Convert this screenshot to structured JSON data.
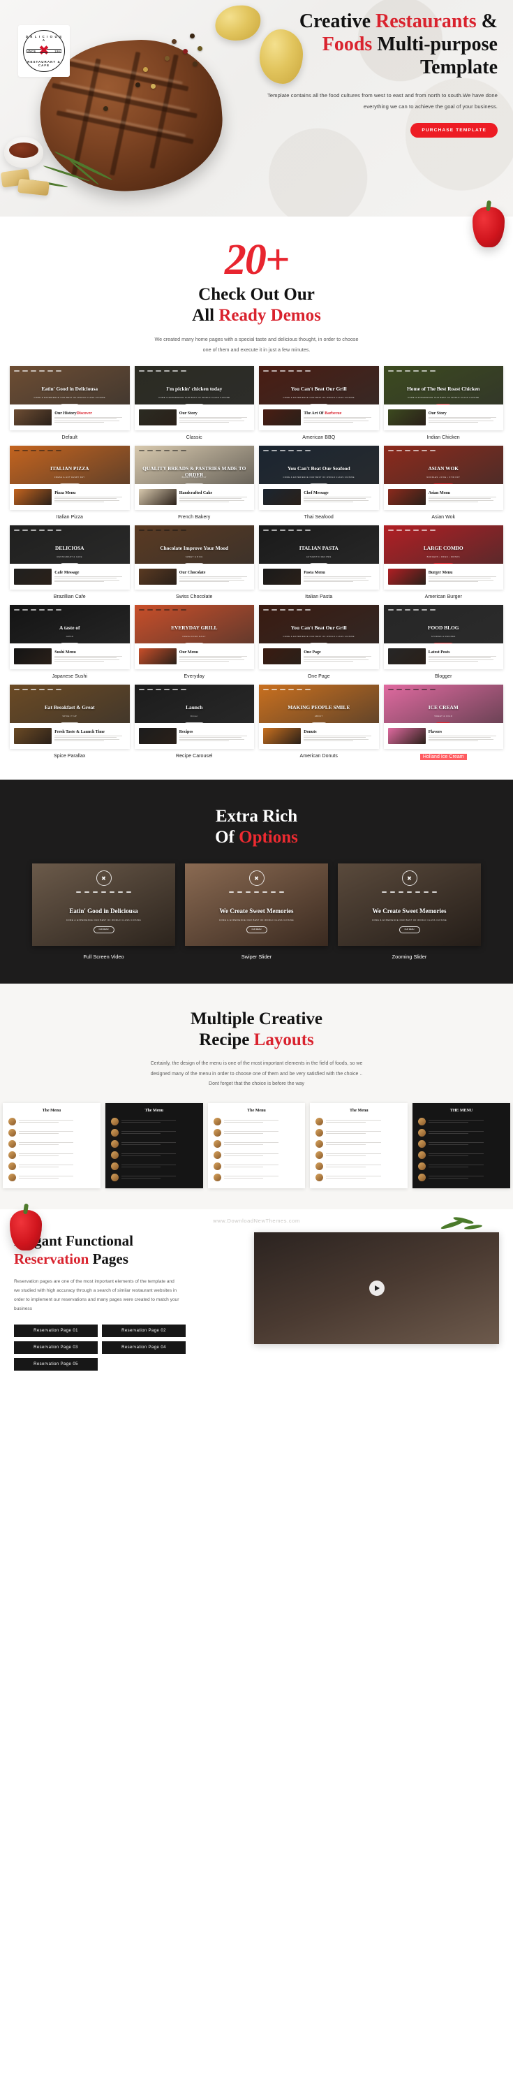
{
  "hero": {
    "logo": {
      "brand": "DELICIOUSA",
      "top_arc": "D E L I C I O U S A",
      "bottom_arc": "RESTAURANT & CAFE",
      "since_left": "SINCE",
      "since_right": "1962",
      "icon": "crossed-fork-spoon-icon"
    },
    "title_line1_a": "Creative ",
    "title_line1_b": "Restaurants ",
    "title_line1_c": "&",
    "title_line2_a": "Foods",
    "title_line2_b": " Multi-purpose",
    "title_line3": "Template",
    "subtitle": "Template contains all the food cultures from west to east and from north to south.We have done everything we can to achieve the goal of your business.",
    "cta_label": "PURCHASE TEMPLATE",
    "cta_color": "#ed1c24"
  },
  "demos": {
    "count_badge": "20+",
    "title_line1": "Check Out Our",
    "title_line2_a": "All ",
    "title_line2_b": "Ready Demos",
    "description": "We created many home pages with a special taste and delicious thought, in order to choose one of them and execute it in just a few minutes.",
    "items": [
      {
        "label": "Default",
        "headline": "Eatin' Good in Deliciousa",
        "sub": "COME & EXPERIENCE OUR BEST OF WORLD CLASS CUISINE",
        "btn": "OUR MENU",
        "lower_title": "Our History",
        "lower_script": "Discover",
        "theme": "dark",
        "accent": "#6d4d33"
      },
      {
        "label": "Classic",
        "headline": "I'm pickin' chicken today",
        "sub": "COME & EXPERIENCE OUR BEST OF WORLD CLASS CUISINE",
        "btn": "OUR MENU",
        "lower_title": "Our Story",
        "lower_script": "",
        "theme": "dark",
        "accent": "#2b2b22"
      },
      {
        "label": "American BBQ",
        "headline": "You Can't Beat Our Grill",
        "sub": "COME & EXPERIENCE OUR BEST OF WORLD CLASS CUISINE",
        "btn": "OUR MENU",
        "lower_title": "The Art Of ",
        "lower_script": "Barbecue",
        "theme": "dark",
        "accent": "#4a1d13"
      },
      {
        "label": "Indian Chicken",
        "headline": "Home of The Best Roast Chicken",
        "sub": "COME & EXPERIENCE OUR BEST OF WORLD CLASS CUISINE",
        "btn": "ORDER",
        "lower_title": "Our Story",
        "lower_script": "",
        "theme": "dark",
        "accent": "#3c4a1f"
      },
      {
        "label": "Italian Pizza",
        "headline": "ITALIAN PIZZA",
        "sub": "FRESH & HOT EVERY DAY",
        "btn": "ORDER NOW",
        "lower_title": "Pizza Menu",
        "lower_script": "",
        "theme": "light",
        "accent": "#c4641f"
      },
      {
        "label": "French Bakery",
        "headline": "QUALITY BREADS & PASTRIES MADE TO ORDER",
        "sub": "BAKED FRESH DAILY",
        "btn": "OUR MENU",
        "lower_title": "Handcrafted Cake",
        "lower_script": "",
        "theme": "light",
        "accent": "#d8c9ae"
      },
      {
        "label": "Thai Seafood",
        "headline": "You Can't Beat Our Seafood",
        "sub": "COME & EXPERIENCE OUR BEST OF WORLD CLASS CUISINE",
        "btn": "OUR MENU",
        "lower_title": "Chef Message",
        "lower_script": "",
        "theme": "dark",
        "accent": "#1b2530"
      },
      {
        "label": "Asian Wok",
        "headline": "ASIAN WOK",
        "sub": "NOODLES • RICE • STIR FRY",
        "btn": "ORDER NOW",
        "lower_title": "Asian Menu",
        "lower_script": "",
        "theme": "dark",
        "accent": "#8c2a1c"
      },
      {
        "label": "Brazillian Cafe",
        "headline": "DELICIOSA",
        "sub": "RESTAURANT & CAFE",
        "btn": "OUR MENU",
        "lower_title": "Cafe Message",
        "lower_script": "",
        "theme": "dark",
        "accent": "#20201f"
      },
      {
        "label": "Swiss Chocolate",
        "headline": "Chocolate Improve Your Mood",
        "sub": "SWEET & RICH",
        "btn": "SHOP NOW",
        "lower_title": "Our Chocolate",
        "lower_script": "",
        "theme": "light",
        "accent": "#5a3a22"
      },
      {
        "label": "Italian Pasta",
        "headline": "ITALIAN PASTA",
        "sub": "AUTHENTIC RECIPES",
        "btn": "OUR MENU",
        "lower_title": "Pasta Menu",
        "lower_script": "",
        "theme": "dark",
        "accent": "#1a1a1a"
      },
      {
        "label": "American Burger",
        "headline": "LARGE COMBO",
        "sub": "BURGERS • FRIES • DRINKS",
        "btn": "ORDER NOW",
        "lower_title": "Burger Menu",
        "lower_script": "",
        "theme": "dark",
        "accent": "#b11f24"
      },
      {
        "label": "Japanese Sushi",
        "headline": "A taste of",
        "sub": "JAPAN",
        "btn": "OUR MENU",
        "lower_title": "Sushi Menu",
        "lower_script": "",
        "theme": "dark",
        "accent": "#141414"
      },
      {
        "label": "Everyday",
        "headline": "EVERYDAY GRILL",
        "sub": "FRESH FOOD DAILY",
        "btn": "OUR MENU",
        "lower_title": "Our Menu",
        "lower_script": "",
        "theme": "light",
        "accent": "#c94f2a"
      },
      {
        "label": "One Page",
        "headline": "You Can't Beat Our Grill",
        "sub": "COME & EXPERIENCE OUR BEST OF WORLD CLASS CUISINE",
        "btn": "OUR MENU",
        "lower_title": "One Page",
        "lower_script": "",
        "theme": "dark",
        "accent": "#3a1b11"
      },
      {
        "label": "Blogger",
        "headline": "FOOD BLOG",
        "sub": "STORIES & RECIPES",
        "btn": "READ MORE",
        "lower_title": "Latest Posts",
        "lower_script": "",
        "theme": "dark",
        "accent": "#262626"
      },
      {
        "label": "Spice Parallax",
        "headline": "Eat Breakfast & Great",
        "sub": "SPICE IT UP",
        "btn": "OUR MENU",
        "lower_title": "Fresh Taste & Launch Time",
        "lower_script": "",
        "theme": "dark",
        "accent": "#6b4a24"
      },
      {
        "label": "Recipe Carousel",
        "headline": "Launch",
        "sub": "Dinner",
        "btn": "OUR MENU",
        "lower_title": "Recipes",
        "lower_script": "",
        "theme": "dark",
        "accent": "#1c1c1c"
      },
      {
        "label": "American Donuts",
        "headline": "MAKING PEOPLE SMILE",
        "sub": "ABOUT",
        "btn": "ORDER",
        "lower_title": "Donuts",
        "lower_script": "",
        "theme": "dark",
        "accent": "#c9701f"
      },
      {
        "label": "Holland Ice Cream",
        "headline": "ICE CREAM",
        "sub": "SWEET & COLD",
        "btn": "ORDER",
        "lower_title": "Flavors",
        "lower_script": "",
        "theme": "light",
        "accent": "#e06aa0",
        "highlight": true
      }
    ]
  },
  "options": {
    "title_line1": "Extra Rich",
    "title_line2_a": "Of ",
    "title_line2_b": "Options",
    "items": [
      {
        "label": "Full Screen Video",
        "headline": "Eatin' Good in Deliciousa",
        "sub": "COME & EXPERIENCE OUR BEST OF WORLD CLASS CUISINE",
        "btn": "OUR MENU"
      },
      {
        "label": "Swiper Slider",
        "headline": "We Create Sweet Memories",
        "sub": "COME & EXPERIENCE OUR BEST OF WORLD CLASS CUISINE",
        "btn": "OUR MENU"
      },
      {
        "label": "Zooming Slider",
        "headline": "We Create Sweet Memories",
        "sub": "COME & EXPERIENCE OUR BEST OF WORLD CLASS CUISINE",
        "btn": "OUR MENU"
      }
    ]
  },
  "layouts": {
    "title_line1": "Multiple Creative",
    "title_line2_a": "Recipe ",
    "title_line2_b": "Layouts",
    "description": "Certainly, the design of the menu is one of the most important elements in the field of foods, so we designed many of the menu in order to choose one of them and be very satisfied with the choice .. Dont forget that the choice is before the way",
    "menus": [
      {
        "heading": "The Menu",
        "theme": "light"
      },
      {
        "heading": "The Menu",
        "theme": "dark"
      },
      {
        "heading": "The Menu",
        "theme": "light"
      },
      {
        "heading": "The Menu",
        "theme": "light"
      },
      {
        "heading": "THE MENU",
        "theme": "dark"
      }
    ]
  },
  "watermark": {
    "text": "www.DownloadNewThemes.com"
  },
  "reservation": {
    "title_line1": "Elegant Functional",
    "title_line2_a": "Reservation ",
    "title_line2_b": "Pages",
    "description": "Reservation pages are one of the most important elements of the template and we studied with high accuracy through a search of similar restaurant websites in order to implement our reservations and many pages were created to match your business",
    "buttons": [
      "Reservation Page 01",
      "Reservation Page 02",
      "Reservation Page 03",
      "Reservation Page 04",
      "Reservation Page 05"
    ],
    "video_play_icon": "play-icon"
  }
}
